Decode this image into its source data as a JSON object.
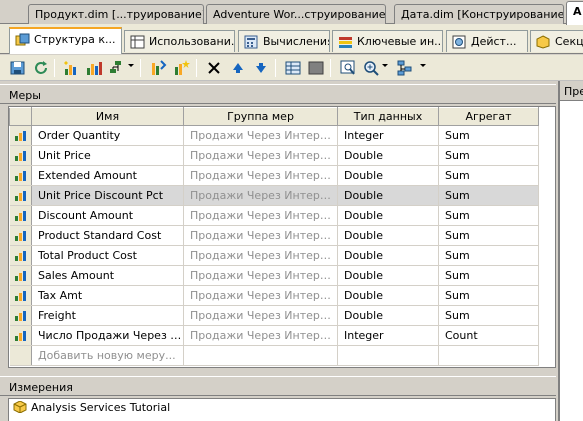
{
  "doc_tabs": [
    {
      "label": "Продукт.dim [...труирование]*",
      "active": false
    },
    {
      "label": "Adventure Wor...струирование]",
      "active": false
    },
    {
      "label": "Дата.dim [Конструирование]",
      "active": false
    },
    {
      "label": "A",
      "active": true
    }
  ],
  "designer_tabs": [
    {
      "label": "Структура к...",
      "icon": "cube-structure-icon",
      "active": true
    },
    {
      "label": "Использовани...",
      "icon": "dimension-usage-icon",
      "active": false
    },
    {
      "label": "Вычисления",
      "icon": "calculations-icon",
      "active": false
    },
    {
      "label": "Ключевые ин...",
      "icon": "kpi-icon",
      "active": false
    },
    {
      "label": "Дейст...",
      "icon": "actions-icon",
      "active": false
    },
    {
      "label": "Секц",
      "icon": "partitions-icon",
      "active": false
    }
  ],
  "measures_pane": {
    "title": "Меры"
  },
  "grid": {
    "columns": [
      "Имя",
      "Группа мер",
      "Тип данных",
      "Агрегат"
    ],
    "rows": [
      {
        "name": "Order Quantity",
        "group": "Продажи Через Интернет",
        "type": "Integer",
        "agg": "Sum"
      },
      {
        "name": "Unit Price",
        "group": "Продажи Через Интернет",
        "type": "Double",
        "agg": "Sum"
      },
      {
        "name": "Extended Amount",
        "group": "Продажи Через Интернет",
        "type": "Double",
        "agg": "Sum"
      },
      {
        "name": "Unit Price Discount Pct",
        "group": "Продажи Через Интернет",
        "type": "Double",
        "agg": "Sum"
      },
      {
        "name": "Discount Amount",
        "group": "Продажи Через Интернет",
        "type": "Double",
        "agg": "Sum"
      },
      {
        "name": "Product Standard Cost",
        "group": "Продажи Через Интернет",
        "type": "Double",
        "agg": "Sum"
      },
      {
        "name": "Total Product Cost",
        "group": "Продажи Через Интернет",
        "type": "Double",
        "agg": "Sum"
      },
      {
        "name": "Sales Amount",
        "group": "Продажи Через Интернет",
        "type": "Double",
        "agg": "Sum"
      },
      {
        "name": "Tax Amt",
        "group": "Продажи Через Интернет",
        "type": "Double",
        "agg": "Sum"
      },
      {
        "name": "Freight",
        "group": "Продажи Через Интернет",
        "type": "Double",
        "agg": "Sum"
      },
      {
        "name": "Число Продажи Через И...",
        "group": "Продажи Через Интернет",
        "type": "Integer",
        "agg": "Count"
      }
    ],
    "new_row": "Добавить новую меру..."
  },
  "right_pane": {
    "title": "Пре"
  },
  "dimensions_pane": {
    "title": "Измерения",
    "items": [
      "Analysis Services Tutorial"
    ]
  }
}
